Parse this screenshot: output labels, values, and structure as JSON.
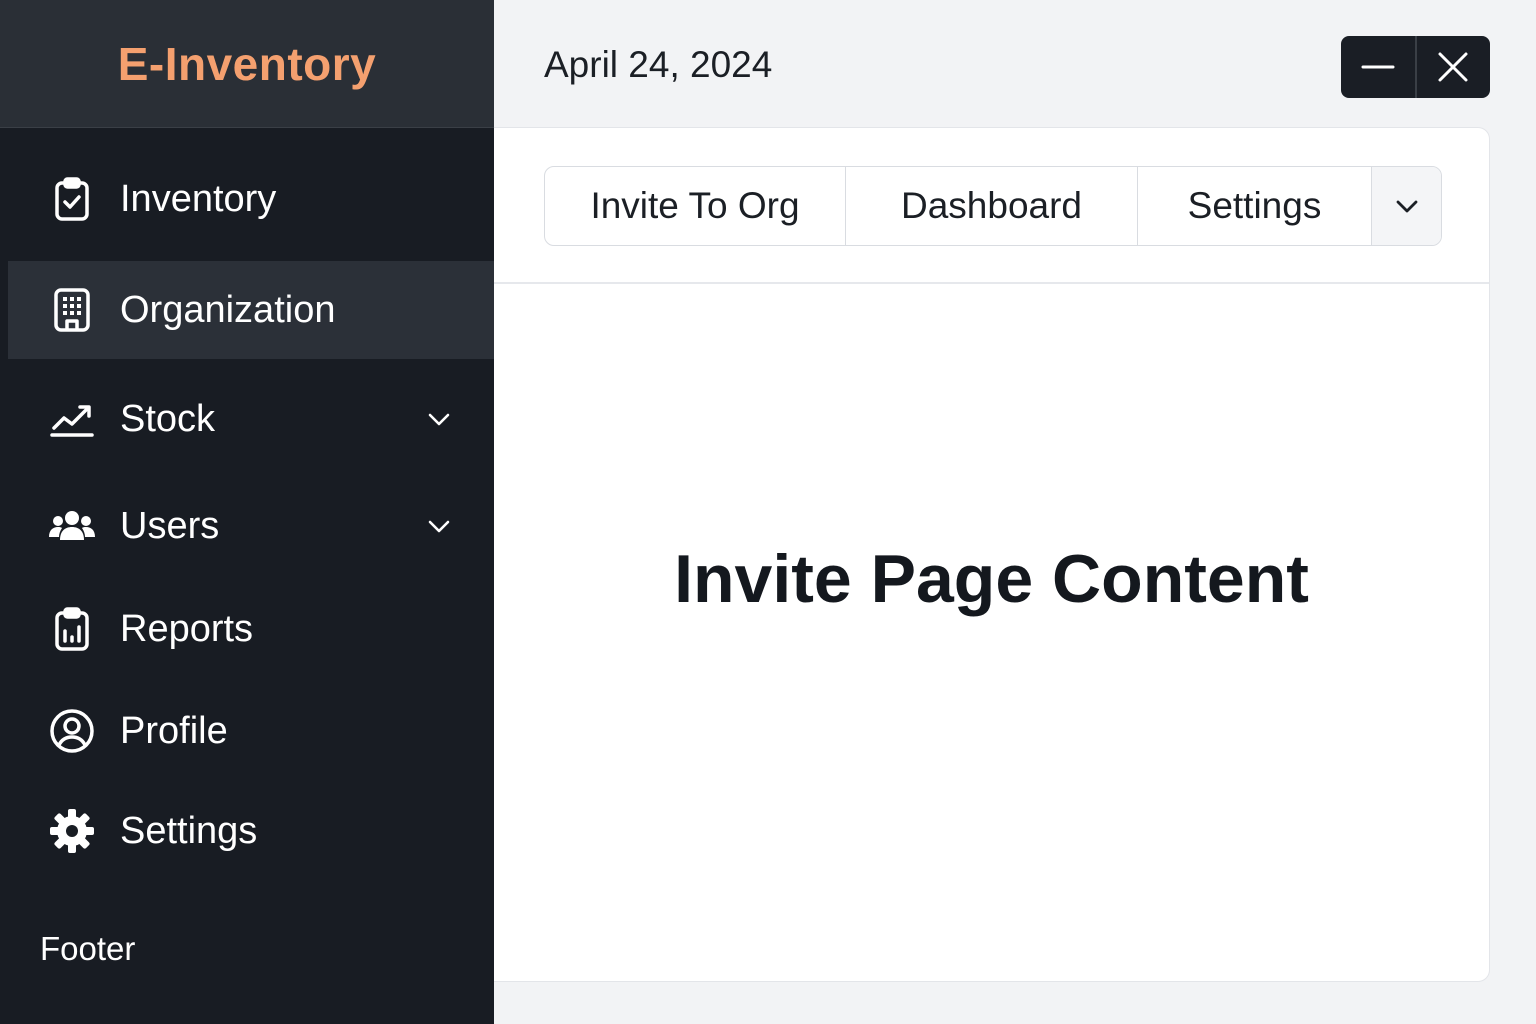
{
  "brand": {
    "title": "E-Inventory",
    "color": "#f4a06f"
  },
  "sidebar": {
    "items": [
      {
        "label": "Inventory",
        "icon": "clipboard-check-icon",
        "active": false,
        "has_dropdown": false
      },
      {
        "label": "Organization",
        "icon": "building-icon",
        "active": true,
        "has_dropdown": false
      },
      {
        "label": "Stock",
        "icon": "trending-chart-icon",
        "active": false,
        "has_dropdown": true
      },
      {
        "label": "Users",
        "icon": "users-icon",
        "active": false,
        "has_dropdown": true
      },
      {
        "label": "Reports",
        "icon": "clipboard-chart-icon",
        "active": false,
        "has_dropdown": false
      },
      {
        "label": "Profile",
        "icon": "user-circle-icon",
        "active": false,
        "has_dropdown": false
      },
      {
        "label": "Settings",
        "icon": "gear-icon",
        "active": false,
        "has_dropdown": false
      }
    ],
    "footer": "Footer"
  },
  "header": {
    "date": "April 24, 2024",
    "window_controls": [
      "minimize-icon",
      "close-icon"
    ]
  },
  "tabs": {
    "items": [
      "Invite To Org",
      "Dashboard",
      "Settings"
    ],
    "more_icon": "chevron-down-icon"
  },
  "main": {
    "heading": "Invite Page Content"
  },
  "colors": {
    "sidebar_bg": "#181c23",
    "brand_bg": "#2a2f36",
    "active_item_bg": "#2b3038",
    "page_bg": "#f2f3f5",
    "accent": "#f4a06f"
  }
}
